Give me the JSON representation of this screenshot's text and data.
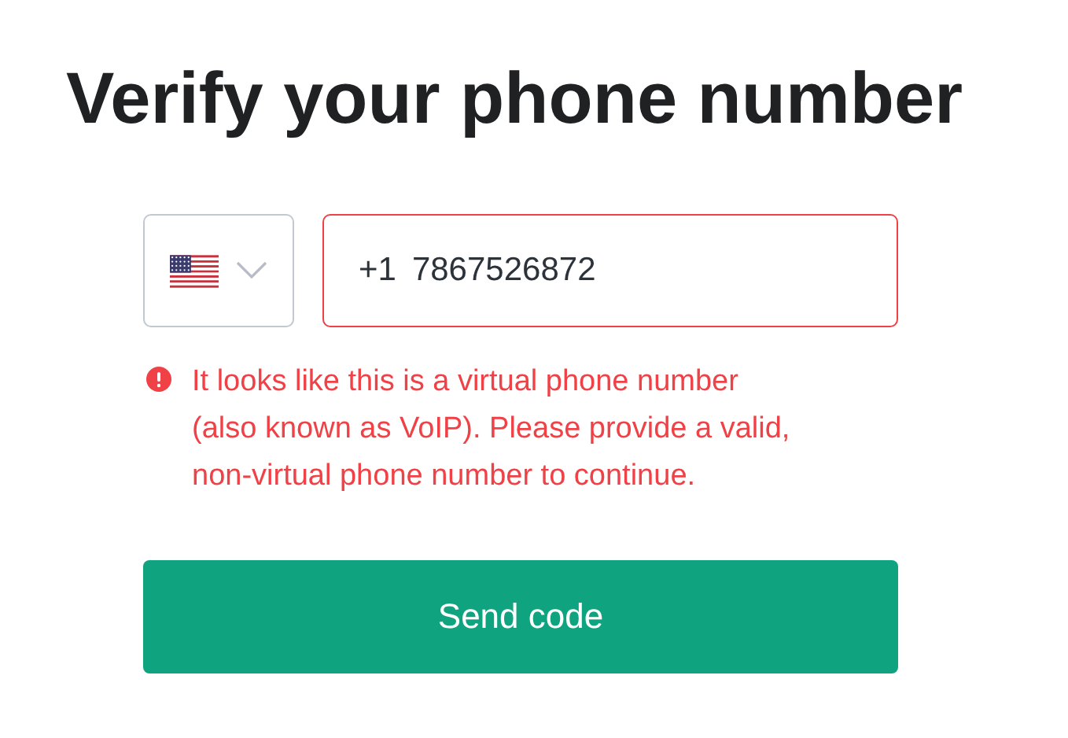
{
  "title": "Verify your phone number",
  "phone": {
    "dial_code": "+1",
    "value": "7867526872",
    "error": true
  },
  "error_message": "It looks like this is a virtual phone number (also known as VoIP). Please provide a valid, non-virtual phone number to continue.",
  "buttons": [
    {
      "label": "Send code"
    }
  ]
}
